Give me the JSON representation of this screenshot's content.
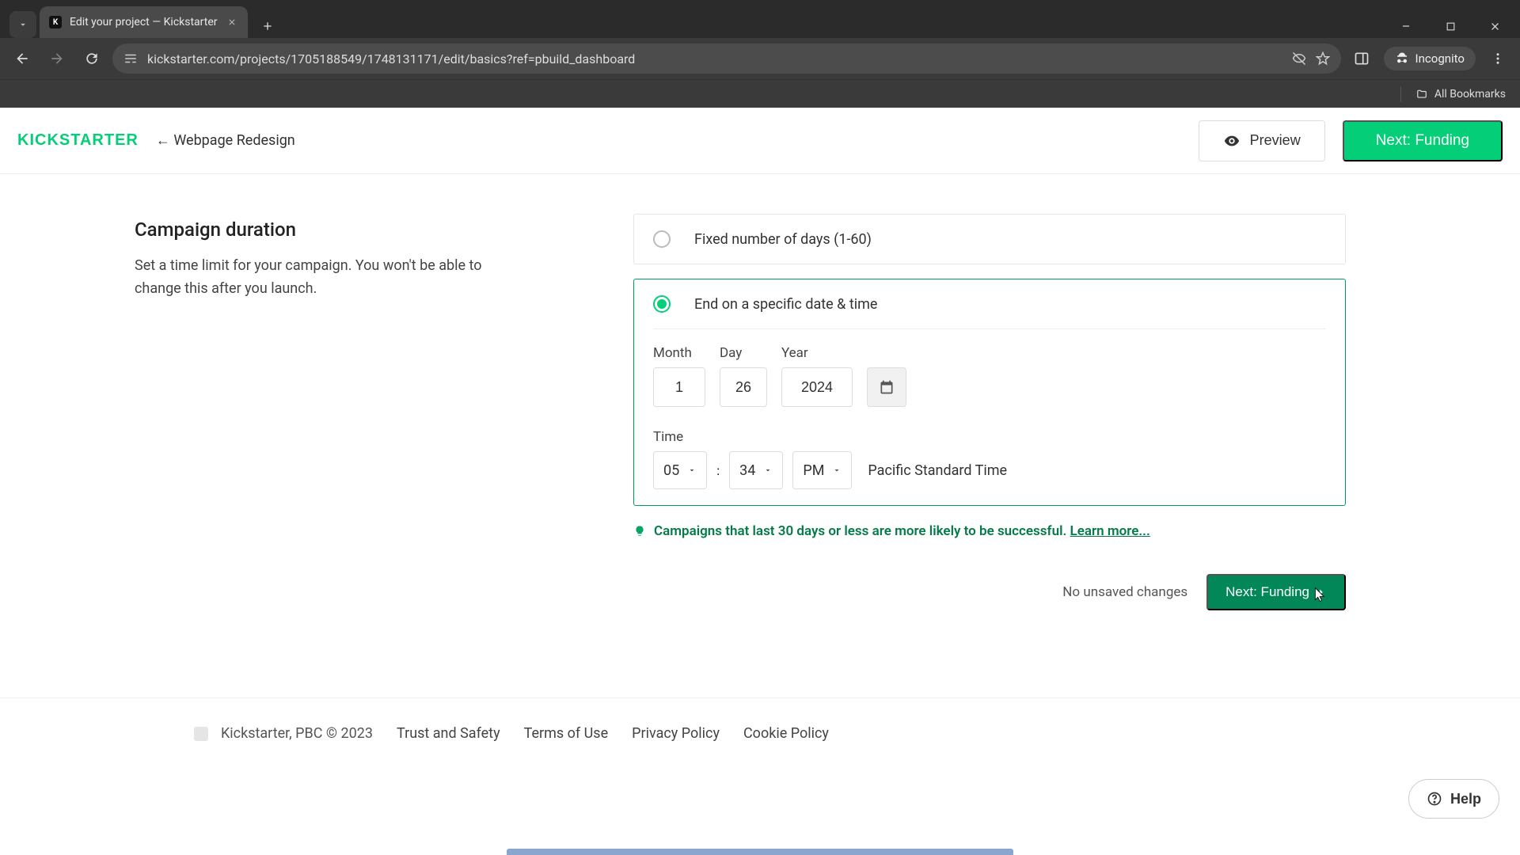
{
  "browser": {
    "tab_title": "Edit your project — Kickstarter",
    "url": "kickstarter.com/projects/1705188549/1748131171/edit/basics?ref=pbuild_dashboard",
    "incognito_label": "Incognito",
    "bookmarks_label": "All Bookmarks"
  },
  "header": {
    "logo": "KICKSTARTER",
    "breadcrumb": "←  Webpage Redesign",
    "preview": "Preview",
    "next": "Next: Funding"
  },
  "section": {
    "title": "Campaign duration",
    "subtitle": "Set a time limit for your campaign. You won't be able to change this after you launch."
  },
  "options": {
    "fixed": "Fixed number of days (1-60)",
    "specific": "End on a specific date & time"
  },
  "date": {
    "labels": {
      "month": "Month",
      "day": "Day",
      "year": "Year"
    },
    "month": "1",
    "day": "26",
    "year": "2024"
  },
  "time": {
    "label": "Time",
    "hour": "05",
    "minute": "34",
    "ampm": "PM",
    "tz": "Pacific Standard Time",
    "colon": ":"
  },
  "tip": {
    "text": "Campaigns that last 30 days or less are more likely to be successful. ",
    "link": "Learn more..."
  },
  "bottom": {
    "unsaved": "No unsaved changes",
    "next": "Next: Funding"
  },
  "footer": {
    "copyright": "Kickstarter, PBC © 2023",
    "links": [
      "Trust and Safety",
      "Terms of Use",
      "Privacy Policy",
      "Cookie Policy"
    ]
  },
  "help": "Help"
}
